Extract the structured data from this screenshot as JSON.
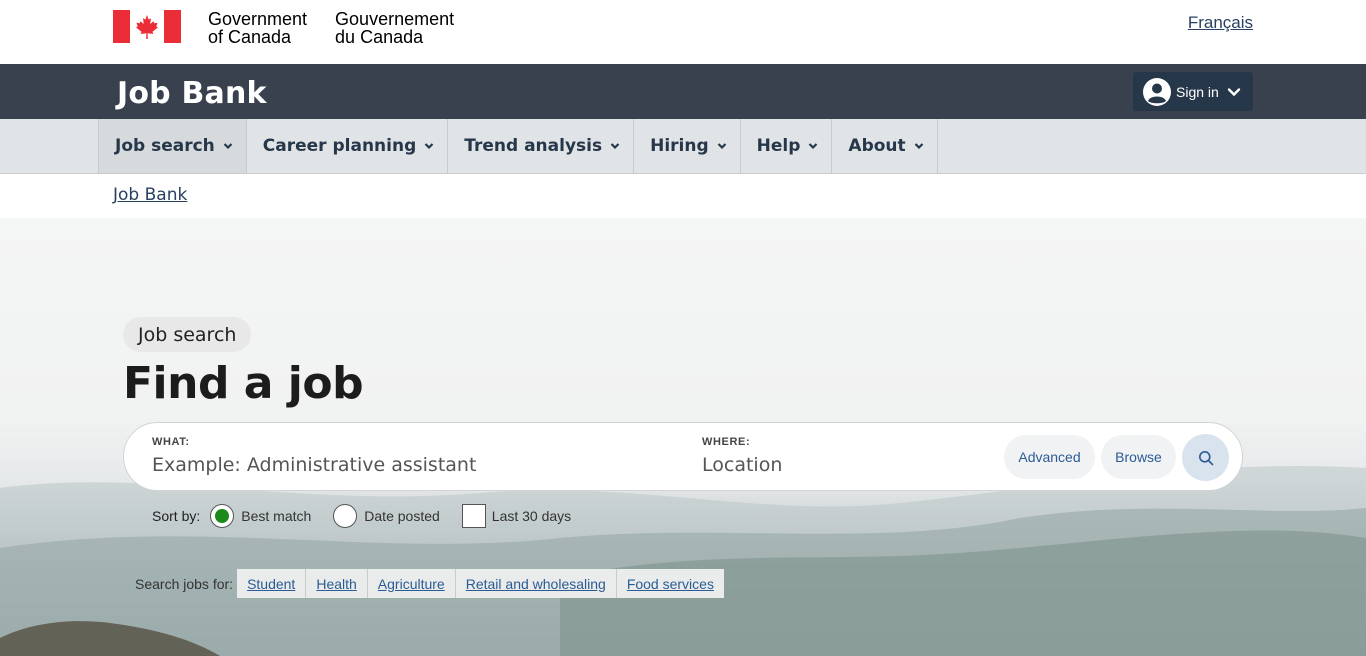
{
  "gov": {
    "en_line1": "Government",
    "en_line2": "of Canada",
    "fr_line1": "Gouvernement",
    "fr_line2": "du Canada",
    "language_link": "Français",
    "flag_red": "#eb2d37"
  },
  "app": {
    "title": "Job Bank",
    "signin_label": "Sign in",
    "bar_color": "#38414d"
  },
  "nav": {
    "items": [
      {
        "label": "Job search"
      },
      {
        "label": "Career planning"
      },
      {
        "label": "Trend analysis"
      },
      {
        "label": "Hiring"
      },
      {
        "label": "Help"
      },
      {
        "label": "About"
      }
    ]
  },
  "breadcrumb": {
    "items": [
      "Job Bank"
    ]
  },
  "hero": {
    "chip": "Job search",
    "title": "Find a job"
  },
  "search": {
    "what_label": "WHAT:",
    "what_placeholder": "Example: Administrative assistant",
    "where_label": "WHERE:",
    "where_placeholder": "Location",
    "advanced_label": "Advanced",
    "browse_label": "Browse"
  },
  "sort": {
    "label": "Sort by:",
    "options": [
      {
        "label": "Best match",
        "checked": true
      },
      {
        "label": "Date posted",
        "checked": false
      }
    ],
    "last30_label": "Last 30 days",
    "last30_checked": false,
    "selected_color": "#1b8a1b"
  },
  "quick": {
    "label": "Search jobs for:",
    "links": [
      "Student",
      "Health",
      "Agriculture",
      "Retail and wholesaling",
      "Food services"
    ]
  }
}
